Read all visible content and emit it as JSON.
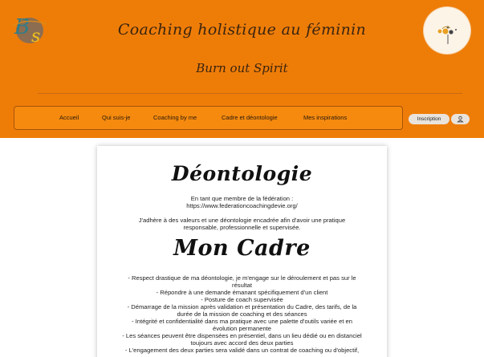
{
  "header": {
    "title": "Coaching holistique au féminin",
    "subtitle": "Burn out Spirit",
    "logo_icon": "bs-monogram-logo-icon",
    "avatar_icon": "decorative-sun-avatar-icon",
    "colors": {
      "background": "#ee7d08",
      "nav": "#f58a0f",
      "text": "#3b2410"
    }
  },
  "nav": {
    "items": [
      {
        "label": "Accueil"
      },
      {
        "label": "Qui suis-je"
      },
      {
        "label": "Coaching by me"
      },
      {
        "label": "Cadre et déontologie"
      },
      {
        "label": "Mes inspirations"
      }
    ]
  },
  "account": {
    "inscription_label": "Inscription",
    "user_icon": "user-icon"
  },
  "content": {
    "deontologie_title": "Déontologie",
    "intro_line1": "En tant que membre de la fédération :",
    "intro_line2": "https://www.federationcoachingdevie.org/",
    "adhere_line1": "J'adhère à des valeurs et une déontologie encadrée afin d'avoir une pratique",
    "adhere_line2": "responsable, professionnelle et supervisée.",
    "cadre_title": "Mon Cadre",
    "cadre_lines": [
      "- Respect drastique de ma déontologie, je m'engage sur le déroulement et pas sur le",
      "résultat",
      "- Répondre à une demande émanant spécifiquement d'un client",
      "- Posture de coach supervisée",
      "- Démarrage de la mission après validation et présentation du Cadre, des tarifs, de la",
      "durée de la mission de coaching et des séances",
      "- Intégrité et confidentialité dans ma pratique avec une palette d'outils variée et en",
      "évolution permanente",
      "- Les séances peuvent être dispensées en présentiel, dans un lieu dédié ou en distanciel",
      "toujours avec accord des deux parties",
      "- L'engagement des deux parties sera validé dans un contrat de coaching ou d'objectif,"
    ]
  }
}
